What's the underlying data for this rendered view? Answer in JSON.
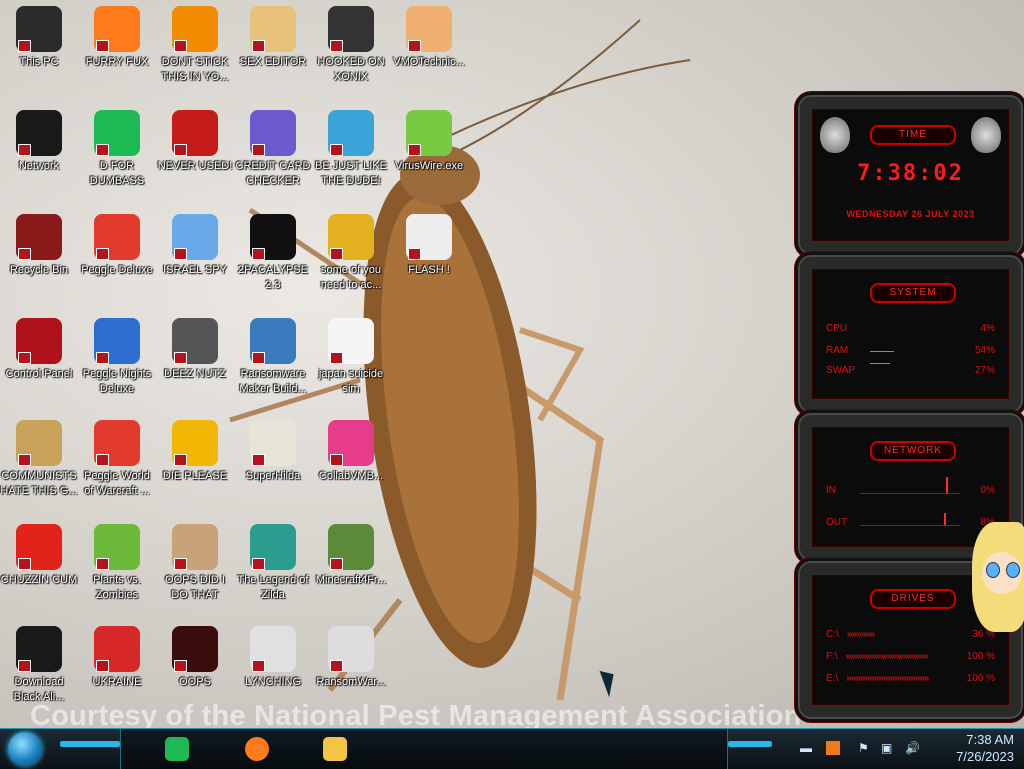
{
  "wallpaper": {
    "caption": "Courtesy of the National Pest Management Association"
  },
  "desktop": {
    "icons": [
      {
        "label": "This PC",
        "icon": "computer-icon",
        "color": "#2b2b2b"
      },
      {
        "label": "FURRY FUX",
        "icon": "firefox-icon",
        "color": "#ff7a1a"
      },
      {
        "label": "DONT STICK THIS IN YO...",
        "icon": "vlc-cone-icon",
        "color": "#f28c00"
      },
      {
        "label": "SEX EDITOR",
        "icon": "hxd-icon",
        "color": "#e8c27a"
      },
      {
        "label": "HOOKED ON XONIX",
        "icon": "xonix-icon",
        "color": "#333333"
      },
      {
        "label": "VMOTechnic...",
        "icon": "doctor-icon",
        "color": "#f0b070"
      },
      {
        "label": "Network",
        "icon": "alienware-icon",
        "color": "#1a1a1a"
      },
      {
        "label": "D FOR DUMBASS",
        "icon": "notes-icon",
        "color": "#1db954"
      },
      {
        "label": "NEVER USED!",
        "icon": "devcpp-icon",
        "color": "#c51b1b"
      },
      {
        "label": "CREDIT CARD CHECKER",
        "icon": "credit-card-icon",
        "color": "#6a5acd"
      },
      {
        "label": "BE JUST LIKE THE DUDE!",
        "icon": "elf-icon",
        "color": "#3aa3d8"
      },
      {
        "label": "VirusWire.exe",
        "icon": "lime-icon",
        "color": "#7ac943"
      },
      {
        "label": "Recycle Bin",
        "icon": "recycle-bin-icon",
        "color": "#8a1a1a"
      },
      {
        "label": "Peggle Deluxe",
        "icon": "peggle-icon",
        "color": "#e23b2e"
      },
      {
        "label": "ISRAEL SPY",
        "icon": "screen-icon",
        "color": "#6aa9e9"
      },
      {
        "label": "2PACALYPSE 2.3",
        "icon": "terminal-icon",
        "color": "#111111"
      },
      {
        "label": "some of you need to ac...",
        "icon": "dog-icon",
        "color": "#e3b020"
      },
      {
        "label": "FLASH !",
        "icon": "flash-icon",
        "color": "#eeeeee"
      },
      {
        "label": "Control Panel",
        "icon": "control-panel-icon",
        "color": "#b0121a"
      },
      {
        "label": "Peggle Nights Deluxe",
        "icon": "peggle-nights-icon",
        "color": "#2c6fd1"
      },
      {
        "label": "DEEZ NUTZ",
        "icon": "windows-stack-icon",
        "color": "#555555"
      },
      {
        "label": "Ransomware Maker Build...",
        "icon": "window-app-icon",
        "color": "#3a7bbf"
      },
      {
        "label": "japan suicide sim",
        "icon": "japan-sim-icon",
        "color": "#f5f5f5"
      },
      {
        "label": "COMMUNISTS HATE THIS G...",
        "icon": "money-bag-icon",
        "color": "#c8a15a"
      },
      {
        "label": "Peggle World of Warcraft ...",
        "icon": "peggle-wow-icon",
        "color": "#e23b2e"
      },
      {
        "label": "DIE PLEASE",
        "icon": "de-icon",
        "color": "#f2b705"
      },
      {
        "label": "SuperHilda",
        "icon": "pixel-icon",
        "color": "#e8e4d8"
      },
      {
        "label": "CollabVMB...",
        "icon": "collab-icon",
        "color": "#e73c8a"
      },
      {
        "label": "CHUZZIN CUM",
        "icon": "chuzzle-icon",
        "color": "#e2231a"
      },
      {
        "label": "Plants vs. Zombies",
        "icon": "pvz-icon",
        "color": "#6dba3a"
      },
      {
        "label": "OOPS DID I DO THAT",
        "icon": "portrait-icon",
        "color": "#c9a27a"
      },
      {
        "label": "The Legend of Zilda",
        "icon": "zilda-icon",
        "color": "#2a9d8f"
      },
      {
        "label": "Minecraft4Fr...",
        "icon": "minecraft-icon",
        "color": "#5b8a3a"
      },
      {
        "label": "Download Black Ali...",
        "icon": "alienware-icon",
        "color": "#1a1a1a"
      },
      {
        "label": "UKRAINE",
        "icon": "radiation-icon",
        "color": "#d62828"
      },
      {
        "label": "OOPS",
        "icon": "oops-icon",
        "color": "#3a0d0d"
      },
      {
        "label": "LYNCHING",
        "icon": "noose-icon",
        "color": "#e0e0e0"
      },
      {
        "label": "RansomWar...",
        "icon": "skull-icon",
        "color": "#dddddd"
      }
    ]
  },
  "widget": {
    "time": {
      "header": "TIME",
      "clock": "7:38:02",
      "date": "WEDNESDAY 26 JULY 2023"
    },
    "system": {
      "header": "SYSTEM",
      "rows": [
        {
          "label": "CPU",
          "value": "4%"
        },
        {
          "label": "RAM",
          "value": "54%"
        },
        {
          "label": "SWAP",
          "value": "27%"
        }
      ]
    },
    "network": {
      "header": "NETWORK",
      "rows": [
        {
          "label": "IN",
          "value": "0%"
        },
        {
          "label": "OUT",
          "value": "8%"
        }
      ]
    },
    "drives": {
      "header": "DRIVES",
      "rows": [
        {
          "label": "C:\\",
          "value": "36 %"
        },
        {
          "label": "F:\\",
          "value": "100 %"
        },
        {
          "label": "E:\\",
          "value": "100 %"
        }
      ]
    }
  },
  "taskbar": {
    "pinned": [
      {
        "name": "notes-app",
        "icon": "notes-icon",
        "color": "#1db954"
      },
      {
        "name": "firefox",
        "icon": "firefox-icon",
        "color": "#ff7a1a"
      },
      {
        "name": "file-explorer",
        "icon": "folder-icon",
        "color": "#f4c542"
      }
    ],
    "clock_time": "7:38 AM",
    "clock_date": "7/26/2023"
  }
}
